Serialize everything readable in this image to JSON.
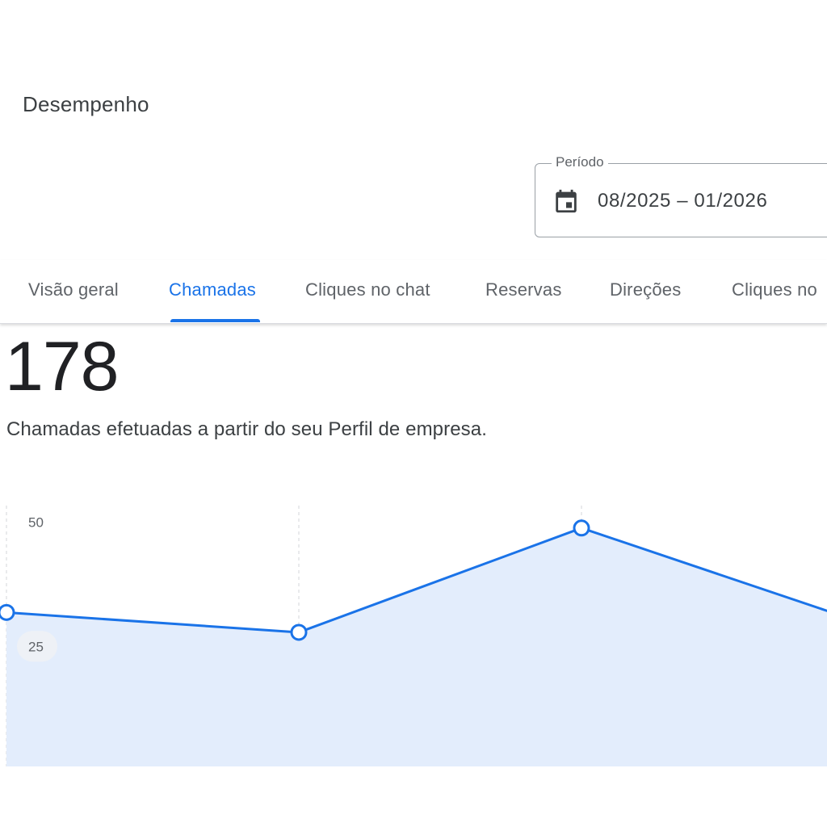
{
  "header": {
    "title": "Desempenho"
  },
  "period": {
    "label": "Período",
    "value": "08/2025 – 01/2026",
    "icon": "calendar-icon"
  },
  "tabs": [
    {
      "label": "Visão geral",
      "active": false
    },
    {
      "label": "Chamadas",
      "active": true
    },
    {
      "label": "Cliques no chat",
      "active": false
    },
    {
      "label": "Reservas",
      "active": false
    },
    {
      "label": "Direções",
      "active": false
    },
    {
      "label": "Cliques no",
      "active": false
    }
  ],
  "metric": {
    "value": "178",
    "description": "Chamadas efetuadas a partir do seu Perfil de empresa."
  },
  "colors": {
    "accent": "#1a73e8",
    "area_fill": "#e3edfc",
    "text": "#202124",
    "muted": "#5f6368"
  },
  "chart_data": {
    "type": "area",
    "x": [
      0,
      1,
      2,
      3
    ],
    "values": [
      31,
      27,
      48,
      31
    ],
    "yticks": [
      "50",
      "25"
    ],
    "ylim": [
      0,
      50
    ],
    "grid": "vertical dashed"
  }
}
